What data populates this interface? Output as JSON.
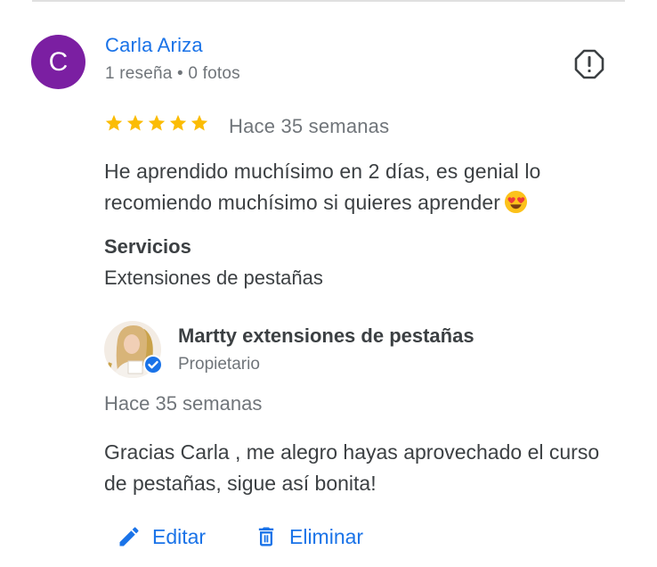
{
  "review": {
    "avatar_letter": "C",
    "avatar_color": "#7b1fa2",
    "reviewer_name": "Carla Ariza",
    "reviewer_meta": "1 reseña • 0 fotos",
    "rating": 5,
    "date": "Hace 35 semanas",
    "text": "He aprendido muchísimo en 2 días, es genial lo recomiendo muchísimo si quieres aprender",
    "emoji": "heart-eyes-emoji",
    "services_heading": "Servicios",
    "services_value": "Extensiones de pestañas"
  },
  "owner_reply": {
    "name": "Martty extensiones de pestañas",
    "role": "Propietario",
    "date": "Hace 35 semanas",
    "text": "Gracias Carla , me alegro hayas aprovechado el curso de pestañas, sigue así bonita!"
  },
  "actions": {
    "edit_label": "Editar",
    "delete_label": "Eliminar"
  },
  "colors": {
    "accent": "#1a73e8",
    "star": "#fbbc04",
    "muted": "#70757a",
    "text": "#3c4043"
  }
}
